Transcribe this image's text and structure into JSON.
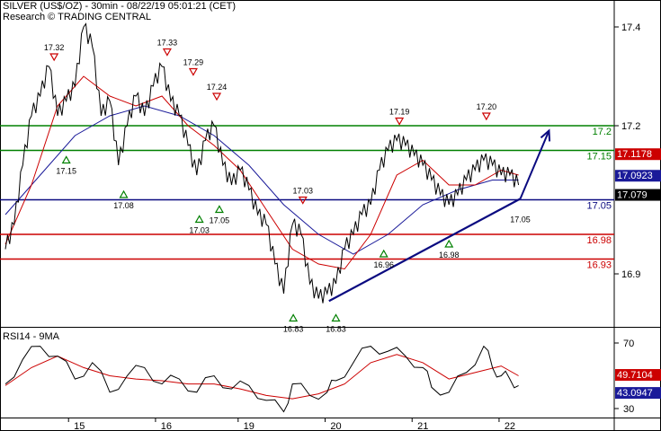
{
  "header": {
    "title": "SILVER (US$/OZ) - 30min - 08/22/19 05:01:21 (CET)",
    "source": "Research © TRADING CENTRAL"
  },
  "colors": {
    "price": "#000000",
    "ma_fast": "#cc0000",
    "ma_slow": "#1a1a99",
    "support": "#0a0a80",
    "resistance_green": "#008000",
    "red_level": "#cc0000",
    "arrow": "#0a0a80",
    "rsi": "#000000",
    "rsi_ma": "#cc0000"
  },
  "chart_data": [
    {
      "type": "line",
      "title": "SILVER (US$/OZ) - 30min",
      "ylim": [
        16.76,
        17.48
      ],
      "yticks": [
        {
          "value": 17.4,
          "label": "17.4"
        },
        {
          "value": 17.2,
          "label": "17.2"
        },
        {
          "value": 16.9,
          "label": "16.9"
        }
      ],
      "x_labels": [
        {
          "x": 8.5,
          "label": "15"
        },
        {
          "x": 18.5,
          "label": "16"
        },
        {
          "x": 28,
          "label": "19"
        },
        {
          "x": 38,
          "label": "20"
        },
        {
          "x": 48,
          "label": "21"
        },
        {
          "x": 58,
          "label": "22"
        }
      ],
      "x_range": [
        0,
        70
      ],
      "levels": [
        {
          "value": 17.2,
          "label": "17.2",
          "color": "#008000"
        },
        {
          "value": 17.15,
          "label": "17.15",
          "color": "#008000"
        },
        {
          "value": 17.05,
          "label": "17.05",
          "color": "#0a0a80"
        },
        {
          "value": 16.98,
          "label": "16.98",
          "color": "#cc0000"
        },
        {
          "value": 16.93,
          "label": "16.93",
          "color": "#cc0000"
        }
      ],
      "price_tags": [
        {
          "value": 17.1178,
          "label": "17.1178",
          "color": "#cc0000"
        },
        {
          "value": 17.0923,
          "label": "17.0923",
          "color": "#1a1a99"
        },
        {
          "value": 17.079,
          "label": "17.079",
          "color": "#000000"
        }
      ],
      "series": [
        {
          "name": "price",
          "points": [
            [
              0,
              16.95
            ],
            [
              1,
              17.0
            ],
            [
              2,
              17.12
            ],
            [
              3,
              17.22
            ],
            [
              4,
              17.26
            ],
            [
              5,
              17.32
            ],
            [
              6,
              17.22
            ],
            [
              7,
              17.25
            ],
            [
              8,
              17.28
            ],
            [
              9,
              17.4
            ],
            [
              10,
              17.36
            ],
            [
              11,
              17.22
            ],
            [
              12,
              17.25
            ],
            [
              13,
              17.12
            ],
            [
              14,
              17.2
            ],
            [
              15,
              17.26
            ],
            [
              16,
              17.22
            ],
            [
              17,
              17.28
            ],
            [
              18,
              17.32
            ],
            [
              19,
              17.25
            ],
            [
              20,
              17.22
            ],
            [
              21,
              17.16
            ],
            [
              22,
              17.1
            ],
            [
              23,
              17.17
            ],
            [
              24,
              17.2
            ],
            [
              25,
              17.12
            ],
            [
              26,
              17.08
            ],
            [
              27,
              17.11
            ],
            [
              28,
              17.07
            ],
            [
              29,
              17.02
            ],
            [
              30,
              17.0
            ],
            [
              31,
              16.92
            ],
            [
              32,
              16.86
            ],
            [
              33,
              17.0
            ],
            [
              34,
              16.98
            ],
            [
              35,
              16.88
            ],
            [
              36,
              16.85
            ],
            [
              37,
              16.86
            ],
            [
              38,
              16.88
            ],
            [
              39,
              16.95
            ],
            [
              40,
              16.98
            ],
            [
              41,
              17.02
            ],
            [
              42,
              17.04
            ],
            [
              43,
              17.11
            ],
            [
              44,
              17.15
            ],
            [
              45,
              17.17
            ],
            [
              46,
              17.16
            ],
            [
              47,
              17.14
            ],
            [
              48,
              17.12
            ],
            [
              49,
              17.09
            ],
            [
              50,
              17.06
            ],
            [
              51,
              17.04
            ],
            [
              52,
              17.06
            ],
            [
              53,
              17.09
            ],
            [
              54,
              17.11
            ],
            [
              55,
              17.13
            ],
            [
              56,
              17.12
            ],
            [
              57,
              17.1
            ],
            [
              58,
              17.1
            ],
            [
              59,
              17.08
            ]
          ]
        },
        {
          "name": "ma_fast",
          "points": [
            [
              0,
              16.96
            ],
            [
              3,
              17.08
            ],
            [
              6,
              17.24
            ],
            [
              9,
              17.3
            ],
            [
              12,
              17.26
            ],
            [
              15,
              17.24
            ],
            [
              18,
              17.26
            ],
            [
              21,
              17.2
            ],
            [
              24,
              17.16
            ],
            [
              27,
              17.11
            ],
            [
              30,
              17.03
            ],
            [
              33,
              16.95
            ],
            [
              36,
              16.92
            ],
            [
              39,
              16.91
            ],
            [
              42,
              16.98
            ],
            [
              45,
              17.1
            ],
            [
              48,
              17.13
            ],
            [
              51,
              17.08
            ],
            [
              54,
              17.08
            ],
            [
              57,
              17.11
            ],
            [
              59,
              17.1
            ]
          ]
        },
        {
          "name": "ma_slow",
          "points": [
            [
              0,
              17.02
            ],
            [
              4,
              17.1
            ],
            [
              8,
              17.18
            ],
            [
              12,
              17.22
            ],
            [
              16,
              17.24
            ],
            [
              20,
              17.22
            ],
            [
              24,
              17.18
            ],
            [
              28,
              17.12
            ],
            [
              32,
              17.04
            ],
            [
              36,
              16.98
            ],
            [
              40,
              16.94
            ],
            [
              44,
              16.98
            ],
            [
              48,
              17.04
            ],
            [
              52,
              17.07
            ],
            [
              56,
              17.09
            ],
            [
              59,
              17.09
            ]
          ]
        }
      ],
      "trendline": {
        "from": [
          37.2,
          16.845
        ],
        "to": [
          59.2,
          17.052
        ],
        "color": "#0a0a80"
      },
      "projection_arrow": {
        "from": [
          59.2,
          17.052
        ],
        "to": [
          62.5,
          17.19
        ]
      },
      "annotations": [
        {
          "x": 5.6,
          "value": 17.32,
          "label": "17.32",
          "dir": "down"
        },
        {
          "x": 18.6,
          "value": 17.33,
          "label": "17.33",
          "dir": "down"
        },
        {
          "x": 21.6,
          "value": 17.29,
          "label": "17.29",
          "dir": "down"
        },
        {
          "x": 24.3,
          "value": 17.24,
          "label": "17.24",
          "dir": "down"
        },
        {
          "x": 34.2,
          "value": 17.03,
          "label": "17.03",
          "dir": "down"
        },
        {
          "x": 45.3,
          "value": 17.19,
          "label": "17.19",
          "dir": "down"
        },
        {
          "x": 55.3,
          "value": 17.2,
          "label": "17.20",
          "dir": "down"
        },
        {
          "x": 7.0,
          "value": 17.15,
          "label": "17.15",
          "dir": "up"
        },
        {
          "x": 13.6,
          "value": 17.08,
          "label": "17.08",
          "dir": "up"
        },
        {
          "x": 22.3,
          "value": 17.03,
          "label": "17.03",
          "dir": "up"
        },
        {
          "x": 24.6,
          "value": 17.05,
          "label": "17.05",
          "dir": "up"
        },
        {
          "x": 43.5,
          "value": 16.96,
          "label": "16.96",
          "dir": "up"
        },
        {
          "x": 51.0,
          "value": 16.98,
          "label": "16.98",
          "dir": "up"
        },
        {
          "x": 33.1,
          "value": 16.83,
          "label": "16.83",
          "dir": "up"
        },
        {
          "x": 38.0,
          "value": 16.83,
          "label": "16.83",
          "dir": "up"
        }
      ],
      "float_labels": [
        {
          "x": 59.2,
          "value": 17.05,
          "label": "17.05"
        }
      ]
    },
    {
      "type": "line",
      "title": "RSI14 - 9MA",
      "ylim": [
        20,
        80
      ],
      "yticks": [
        {
          "value": 70,
          "label": "70"
        },
        {
          "value": 30,
          "label": "30"
        }
      ],
      "price_tags": [
        {
          "value": 49.7104,
          "label": "49.7104",
          "color": "#cc0000"
        },
        {
          "value": 43.0947,
          "label": "43.0947",
          "color": "#1a1a99"
        }
      ],
      "series": [
        {
          "name": "RSI14",
          "points": [
            [
              0,
              45
            ],
            [
              2,
              60
            ],
            [
              4,
              68
            ],
            [
              6,
              62
            ],
            [
              8,
              48
            ],
            [
              10,
              58
            ],
            [
              12,
              40
            ],
            [
              14,
              50
            ],
            [
              16,
              55
            ],
            [
              18,
              45
            ],
            [
              20,
              48
            ],
            [
              22,
              40
            ],
            [
              24,
              50
            ],
            [
              26,
              42
            ],
            [
              28,
              44
            ],
            [
              30,
              35
            ],
            [
              32,
              28
            ],
            [
              33,
              45
            ],
            [
              35,
              38
            ],
            [
              37,
              40
            ],
            [
              38,
              47
            ],
            [
              40,
              58
            ],
            [
              42,
              68
            ],
            [
              44,
              65
            ],
            [
              46,
              62
            ],
            [
              48,
              55
            ],
            [
              49,
              43
            ],
            [
              51,
              40
            ],
            [
              53,
              52
            ],
            [
              55,
              68
            ],
            [
              56,
              55
            ],
            [
              57,
              50
            ],
            [
              58,
              48
            ],
            [
              59,
              44
            ]
          ]
        },
        {
          "name": "9MA",
          "points": [
            [
              0,
              44
            ],
            [
              3,
              55
            ],
            [
              6,
              62
            ],
            [
              9,
              55
            ],
            [
              12,
              50
            ],
            [
              15,
              48
            ],
            [
              18,
              47
            ],
            [
              21,
              45
            ],
            [
              24,
              45
            ],
            [
              27,
              42
            ],
            [
              30,
              38
            ],
            [
              33,
              36
            ],
            [
              36,
              39
            ],
            [
              39,
              45
            ],
            [
              42,
              58
            ],
            [
              45,
              63
            ],
            [
              48,
              58
            ],
            [
              51,
              48
            ],
            [
              54,
              52
            ],
            [
              57,
              56
            ],
            [
              59,
              50
            ]
          ]
        }
      ]
    }
  ]
}
